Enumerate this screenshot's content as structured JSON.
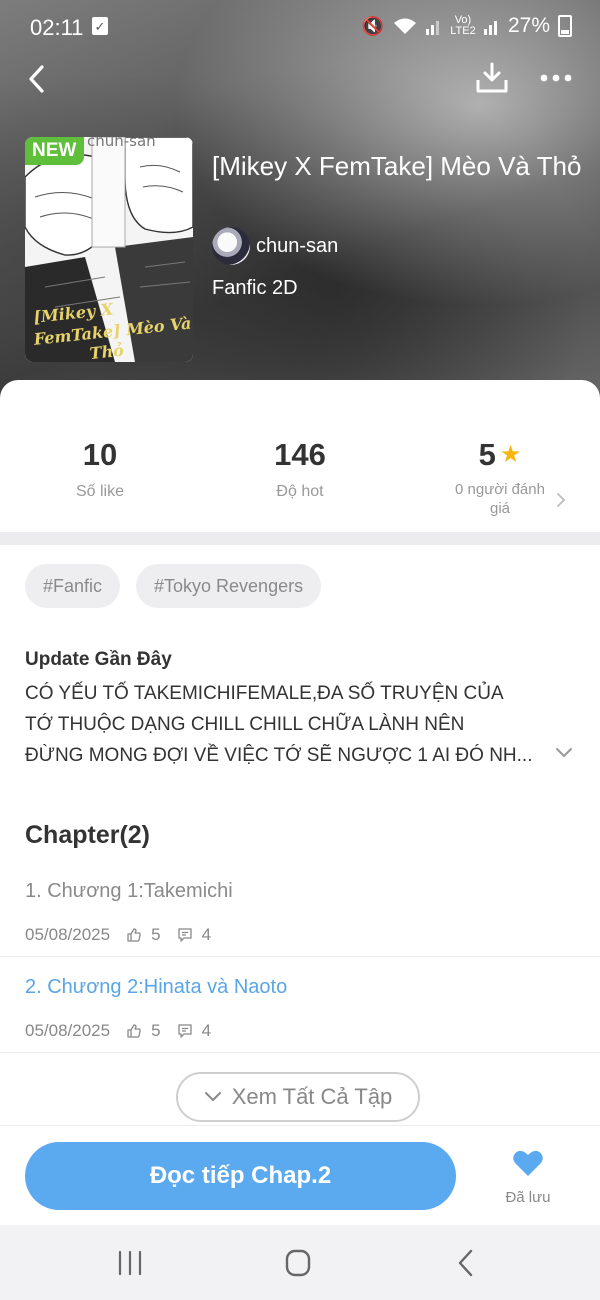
{
  "status_bar": {
    "time": "02:11",
    "network": "Vo) LTE2",
    "battery": "27%"
  },
  "story": {
    "badge": "NEW",
    "title": "[Mikey X FemTake] Mèo Và Thỏ",
    "author": "chun-san",
    "genre": "Fanfic 2D",
    "cover_text": "[Mikey X FemTake] Mèo Và Thỏ",
    "cover_watermark": "chun-san"
  },
  "stats": {
    "likes_value": "10",
    "likes_label": "Số like",
    "hot_value": "146",
    "hot_label": "Độ hot",
    "rating_value": "5",
    "rating_label": "0 người đánh giá"
  },
  "tags": [
    "#Fanfic",
    "#Tokyo Revengers"
  ],
  "update": {
    "title": "Update Gần Đây",
    "line1": "CÓ YẾU TỐ TAKEMICHIFEMALE,ĐA SỐ TRUYỆN CỦA",
    "line2": "TỚ THUỘC DẠNG CHILL CHILL CHỮA LÀNH NÊN",
    "line3": "ĐỪNG MONG ĐỢI VỀ VIỆC TỚ SẼ NGƯỢC 1 AI ĐÓ NH..."
  },
  "chapters": {
    "heading": "Chapter(2)",
    "items": [
      {
        "title": "1. Chương 1:Takemichi",
        "date": "05/08/2025",
        "likes": "5",
        "comments": "4"
      },
      {
        "title": "2. Chương 2:Hinata và Naoto",
        "date": "05/08/2025",
        "likes": "5",
        "comments": "4"
      }
    ],
    "see_all": "Xem Tất Cả Tập"
  },
  "actions": {
    "read_button": "Đọc tiếp Chap.2",
    "saved_label": "Đã lưu"
  },
  "colors": {
    "accent": "#5ba9ee",
    "new_badge": "#5fbf3b",
    "star": "#f6b60f",
    "chapter_active": "#5aa5e8",
    "chapter_inactive": "#8a8a8a"
  },
  "icons": [
    "back-icon",
    "download-icon",
    "more-icon",
    "star-icon",
    "chevron-right-icon",
    "chevron-down-icon",
    "thumb-up-icon",
    "comment-icon",
    "heart-icon",
    "recent-apps-icon",
    "home-icon",
    "system-back-icon"
  ]
}
